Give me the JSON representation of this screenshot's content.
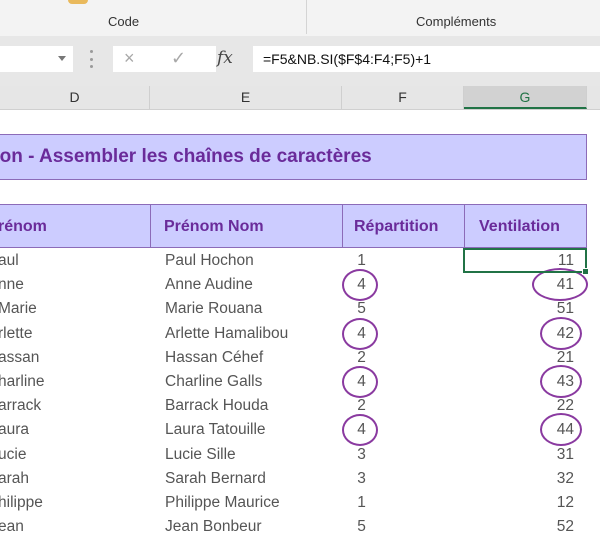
{
  "ribbon": {
    "groups": [
      "Code",
      "Compléments"
    ]
  },
  "formula_bar": {
    "name_box_value": "",
    "cancel_icon": "×",
    "enter_icon": "✓",
    "fx_label": "fx",
    "formula": "=F5&NB.SI($F$4:F4;F5)+1"
  },
  "columns": [
    "D",
    "E",
    "F",
    "G"
  ],
  "selected_column": "G",
  "sheet": {
    "title": "tion - Assembler les chaînes de caractères",
    "headers": [
      "rénom",
      "Prénom Nom",
      "Répartition",
      "Ventilation"
    ],
    "rows": [
      {
        "prenom": "aul",
        "prenom_nom": "Paul Hochon",
        "repartition": "1",
        "ventilation": "11",
        "highlighted": false
      },
      {
        "prenom": "nne",
        "prenom_nom": "Anne Audine",
        "repartition": "4",
        "ventilation": "41",
        "highlighted": true
      },
      {
        "prenom": "Marie",
        "prenom_nom": "Marie Rouana",
        "repartition": "5",
        "ventilation": "51",
        "highlighted": false
      },
      {
        "prenom": "rlette",
        "prenom_nom": "Arlette Hamalibou",
        "repartition": "4",
        "ventilation": "42",
        "highlighted": true
      },
      {
        "prenom": "assan",
        "prenom_nom": "Hassan Céhef",
        "repartition": "2",
        "ventilation": "21",
        "highlighted": false
      },
      {
        "prenom": "harline",
        "prenom_nom": "Charline Galls",
        "repartition": "4",
        "ventilation": "43",
        "highlighted": true
      },
      {
        "prenom": "arrack",
        "prenom_nom": "Barrack Houda",
        "repartition": "2",
        "ventilation": "22",
        "highlighted": false
      },
      {
        "prenom": "aura",
        "prenom_nom": "Laura Tatouille",
        "repartition": "4",
        "ventilation": "44",
        "highlighted": true
      },
      {
        "prenom": "ucie",
        "prenom_nom": "Lucie Sille",
        "repartition": "3",
        "ventilation": "31",
        "highlighted": false
      },
      {
        "prenom": "arah",
        "prenom_nom": "Sarah Bernard",
        "repartition": "3",
        "ventilation": "32",
        "highlighted": false
      },
      {
        "prenom": "hilippe",
        "prenom_nom": "Philippe Maurice",
        "repartition": "1",
        "ventilation": "12",
        "highlighted": false
      },
      {
        "prenom": "ean",
        "prenom_nom": "Jean Bonbeur",
        "repartition": "5",
        "ventilation": "52",
        "highlighted": false
      }
    ]
  },
  "colors": {
    "accent_green": "#217346",
    "header_fill": "#ccccff",
    "header_text": "#6a2b9a",
    "annotation_circle": "#8a3aa0"
  }
}
